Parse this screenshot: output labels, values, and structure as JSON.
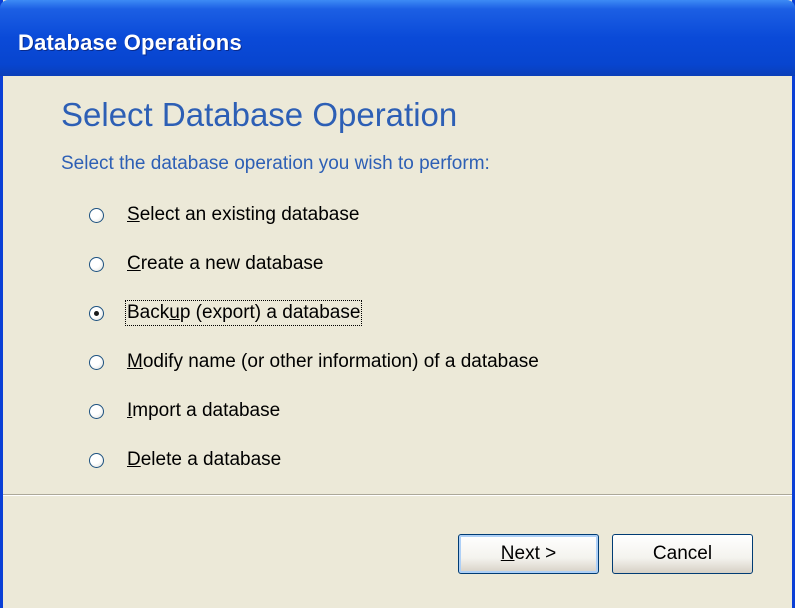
{
  "window": {
    "title": "Database Operations"
  },
  "page": {
    "heading": "Select Database Operation",
    "subtitle": "Select the database operation you wish to perform:"
  },
  "options": [
    {
      "accel": "S",
      "rest": "elect an existing database",
      "pre": "",
      "selected": false
    },
    {
      "accel": "C",
      "rest": "reate a new database",
      "pre": "",
      "selected": false
    },
    {
      "pre": "Back",
      "accel": "u",
      "rest": "p (export) a database",
      "selected": true
    },
    {
      "accel": "M",
      "rest": "odify name (or other information) of a database",
      "pre": "",
      "selected": false
    },
    {
      "accel": "I",
      "rest": "mport a database",
      "pre": "",
      "selected": false
    },
    {
      "accel": "D",
      "rest": "elete a database",
      "pre": "",
      "selected": false
    }
  ],
  "buttons": {
    "next": {
      "accel": "N",
      "rest": "ext >"
    },
    "cancel": {
      "label": "Cancel"
    }
  },
  "colors": {
    "titlebar": "#0a4ad8",
    "heading_blue": "#2d5fb5",
    "dialog_bg": "#ece9d8"
  }
}
